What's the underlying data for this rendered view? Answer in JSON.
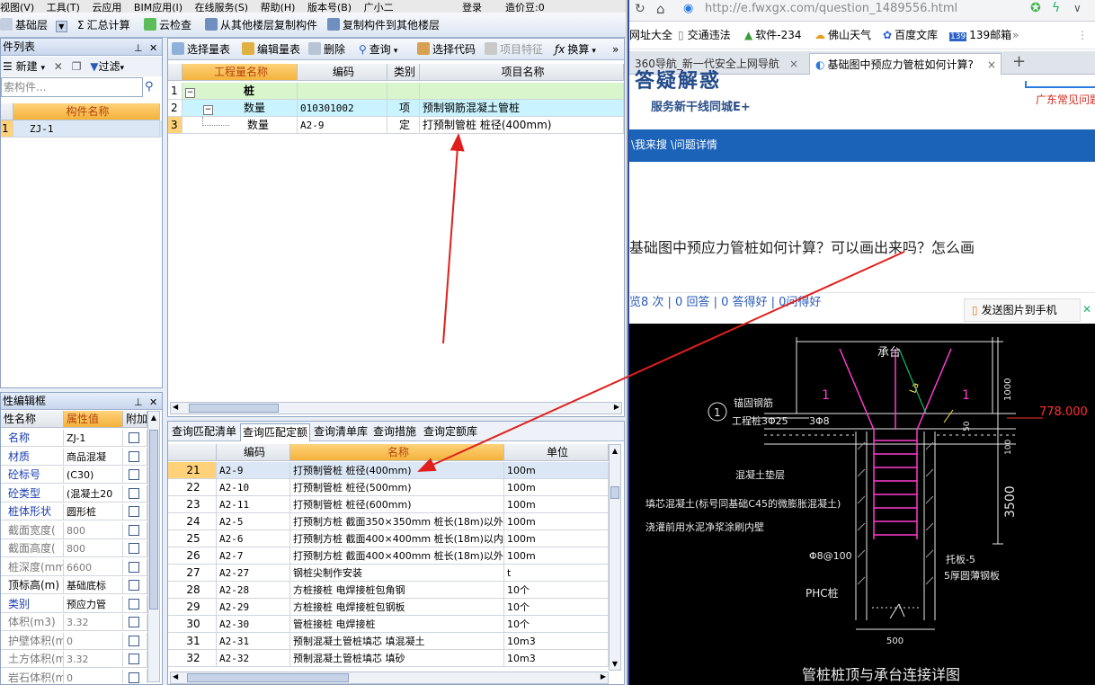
{
  "menu": {
    "items": [
      "视图(V)",
      "工具(T)",
      "云应用",
      "BIM应用(I)",
      "在线服务(S)",
      "帮助(H)",
      "版本号(B)",
      "广小二"
    ],
    "login": "登录",
    "cost": "造价豆:0"
  },
  "toolbar": {
    "floor_select": "基础层",
    "summary": "汇总计算",
    "cloud_check": "云检查",
    "copy_from": "从其他楼层复制构件",
    "copy_to": "复制构件到其他楼层"
  },
  "component_list": {
    "title": "件列表",
    "new": "新建",
    "filter": "过滤",
    "search_placeholder": "索构件...",
    "column": "构件名称",
    "rows": [
      {
        "index": "1",
        "name": "ZJ-1"
      }
    ]
  },
  "quantity_toolbar": {
    "select_table": "选择量表",
    "edit_table": "编辑量表",
    "delete": "删除",
    "query": "查询",
    "select_code": "选择代码",
    "item_feature": "项目特征",
    "convert": "换算"
  },
  "quantity_table": {
    "headers": [
      "工程量名称",
      "编码",
      "类别",
      "项目名称"
    ],
    "rows": [
      {
        "num": "1",
        "name": "桩",
        "code": "",
        "type": "",
        "item": ""
      },
      {
        "num": "2",
        "name": "数量",
        "code": "010301002",
        "type": "项",
        "item": "预制钢筋混凝土管桩"
      },
      {
        "num": "3",
        "name": "数量",
        "code": "A2-9",
        "type": "定",
        "item": "打预制管桩 桩径(400mm)"
      }
    ]
  },
  "query_tabs": [
    "查询匹配清单",
    "查询匹配定额",
    "查询清单库",
    "查询措施",
    "查询定额库"
  ],
  "quota_table": {
    "headers": [
      "编码",
      "名称",
      "单位"
    ],
    "rows": [
      {
        "num": "21",
        "code": "A2-9",
        "name": "打预制管桩 桩径(400mm)",
        "unit": "100m"
      },
      {
        "num": "22",
        "code": "A2-10",
        "name": "打预制管桩 桩径(500mm)",
        "unit": "100m"
      },
      {
        "num": "23",
        "code": "A2-11",
        "name": "打预制管桩 桩径(600mm)",
        "unit": "100m"
      },
      {
        "num": "24",
        "code": "A2-5",
        "name": "打预制方桩 截面350×350mm 桩长(18m)以外",
        "unit": "100m"
      },
      {
        "num": "25",
        "code": "A2-6",
        "name": "打预制方桩 截面400×400mm 桩长(18m)以内",
        "unit": "100m"
      },
      {
        "num": "26",
        "code": "A2-7",
        "name": "打预制方桩 截面400×400mm 桩长(18m)以外",
        "unit": "100m"
      },
      {
        "num": "27",
        "code": "A2-27",
        "name": "钢桩尖制作安装",
        "unit": "t"
      },
      {
        "num": "28",
        "code": "A2-28",
        "name": "方桩接桩 电焊接桩包角钢",
        "unit": "10个"
      },
      {
        "num": "29",
        "code": "A2-29",
        "name": "方桩接桩 电焊接桩包钢板",
        "unit": "10个"
      },
      {
        "num": "30",
        "code": "A2-30",
        "name": "管桩接桩 电焊接桩",
        "unit": "10个"
      },
      {
        "num": "31",
        "code": "A2-31",
        "name": "预制混凝土管桩填芯 填混凝土",
        "unit": "10m3"
      },
      {
        "num": "32",
        "code": "A2-32",
        "name": "预制混凝土管桩填芯 填砂",
        "unit": "10m3"
      }
    ]
  },
  "property_editor": {
    "title": "性编辑框",
    "headers": [
      "性名称",
      "属性值",
      "附加"
    ],
    "rows": [
      {
        "name": "名称",
        "value": "ZJ-1",
        "style": "blue"
      },
      {
        "name": "材质",
        "value": "商品混凝",
        "style": "blue"
      },
      {
        "name": "砼标号",
        "value": "(C30)",
        "style": "blue"
      },
      {
        "name": "砼类型",
        "value": "(混凝土20",
        "style": "blue"
      },
      {
        "name": "桩体形状",
        "value": "圆形桩",
        "style": "blue"
      },
      {
        "name": "截面宽度(",
        "value": "800",
        "style": "gray"
      },
      {
        "name": "截面高度(",
        "value": "800",
        "style": "gray"
      },
      {
        "name": "桩深度(mm)",
        "value": "6600",
        "style": "gray"
      },
      {
        "name": "顶标高(m)",
        "value": "基础底标",
        "style": "black"
      },
      {
        "name": "类别",
        "value": "预应力管",
        "style": "blue"
      },
      {
        "name": "体积(m3)",
        "value": "3.32",
        "style": "gray"
      },
      {
        "name": "护壁体积(m",
        "value": "0",
        "style": "gray"
      },
      {
        "name": "土方体积(m",
        "value": "3.32",
        "style": "gray"
      },
      {
        "name": "岩石体积(m",
        "value": "0",
        "style": "gray"
      }
    ]
  },
  "browser": {
    "url": "http://e.fwxgx.com/question_1489556.html",
    "bookmarks": [
      "网址大全",
      "交通违法",
      "软件-234",
      "佛山天气",
      "百度文库",
      "139邮箱"
    ],
    "tabs": [
      "360导航_新一代安全上网导航",
      "基础图中预应力管桩如何计算?"
    ],
    "banner_title": "答疑解惑",
    "banner_sub": "服务新干线同城E+",
    "region": "广东常见问题",
    "nav": "\\我来搜 \\问题详情",
    "question": "基础图中预应力管桩如何计算？可以画出来吗？怎么画",
    "stats": "览8 次 | 0 回答 | 0 答得好 | 0问得好",
    "send_to_phone": "发送图片到手机"
  },
  "drawing": {
    "title": "管桩桩顶与承台连接详图",
    "labels": {
      "cap": "承台",
      "anchor": "锚固钢筋",
      "pile_code": "工程桩3Φ25",
      "bar_3": "3Φ8",
      "cushion": "混凝土垫层",
      "fill": "填芯混凝土(标号同基础C45的微膨胀混凝土)",
      "clean": "浇灌前用水泥净浆涂刷内壁",
      "stirrup": "Φ8@100",
      "pile_type": "PHC桩",
      "plate": "托板-5",
      "plate_note": "5厚圆薄钢板",
      "la": "La",
      "mark_1": "1",
      "elev": "778.000",
      "d1000": "1000",
      "d100": "100",
      "d50": "50",
      "d3500": "3500",
      "d500": "500",
      "circle_no": "1"
    }
  }
}
